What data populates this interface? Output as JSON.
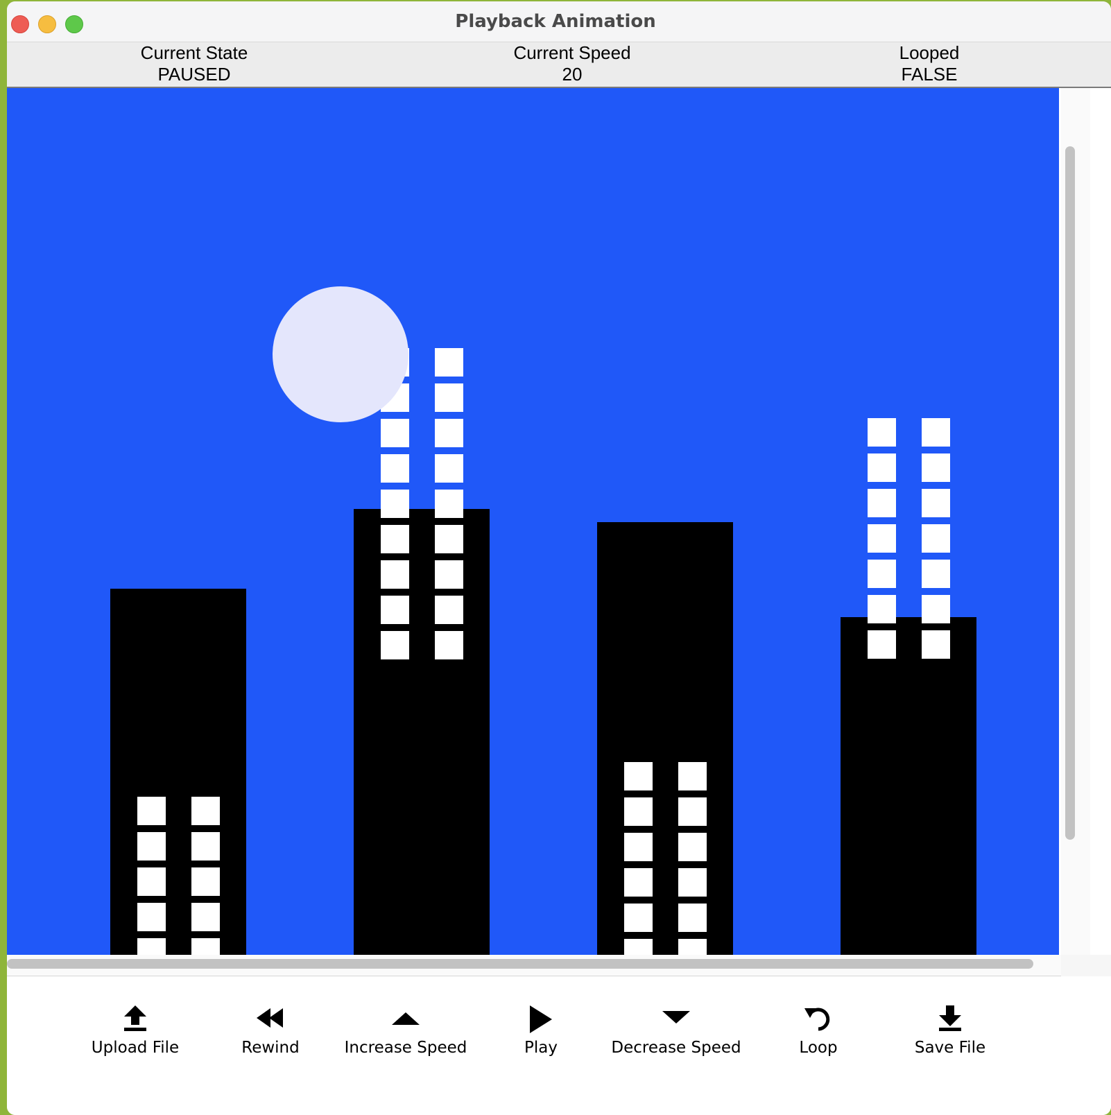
{
  "window": {
    "title": "Playback Animation"
  },
  "status": {
    "state_label": "Current State",
    "state_value": "PAUSED",
    "speed_label": "Current Speed",
    "speed_value": "20",
    "loop_label": "Looped",
    "loop_value": "FALSE"
  },
  "colors": {
    "sky": "#2058f8",
    "building": "#000000",
    "window": "#ffffff",
    "moon": "#e4e6fc"
  },
  "controls": [
    {
      "label": "Upload File",
      "icon": "upload-icon"
    },
    {
      "label": "Rewind",
      "icon": "rewind-icon"
    },
    {
      "label": "Increase Speed",
      "icon": "triangle-up-icon"
    },
    {
      "label": "Play",
      "icon": "play-icon"
    },
    {
      "label": "Decrease Speed",
      "icon": "triangle-down-icon"
    },
    {
      "label": "Loop",
      "icon": "loop-icon"
    },
    {
      "label": "Save File",
      "icon": "download-icon"
    }
  ]
}
